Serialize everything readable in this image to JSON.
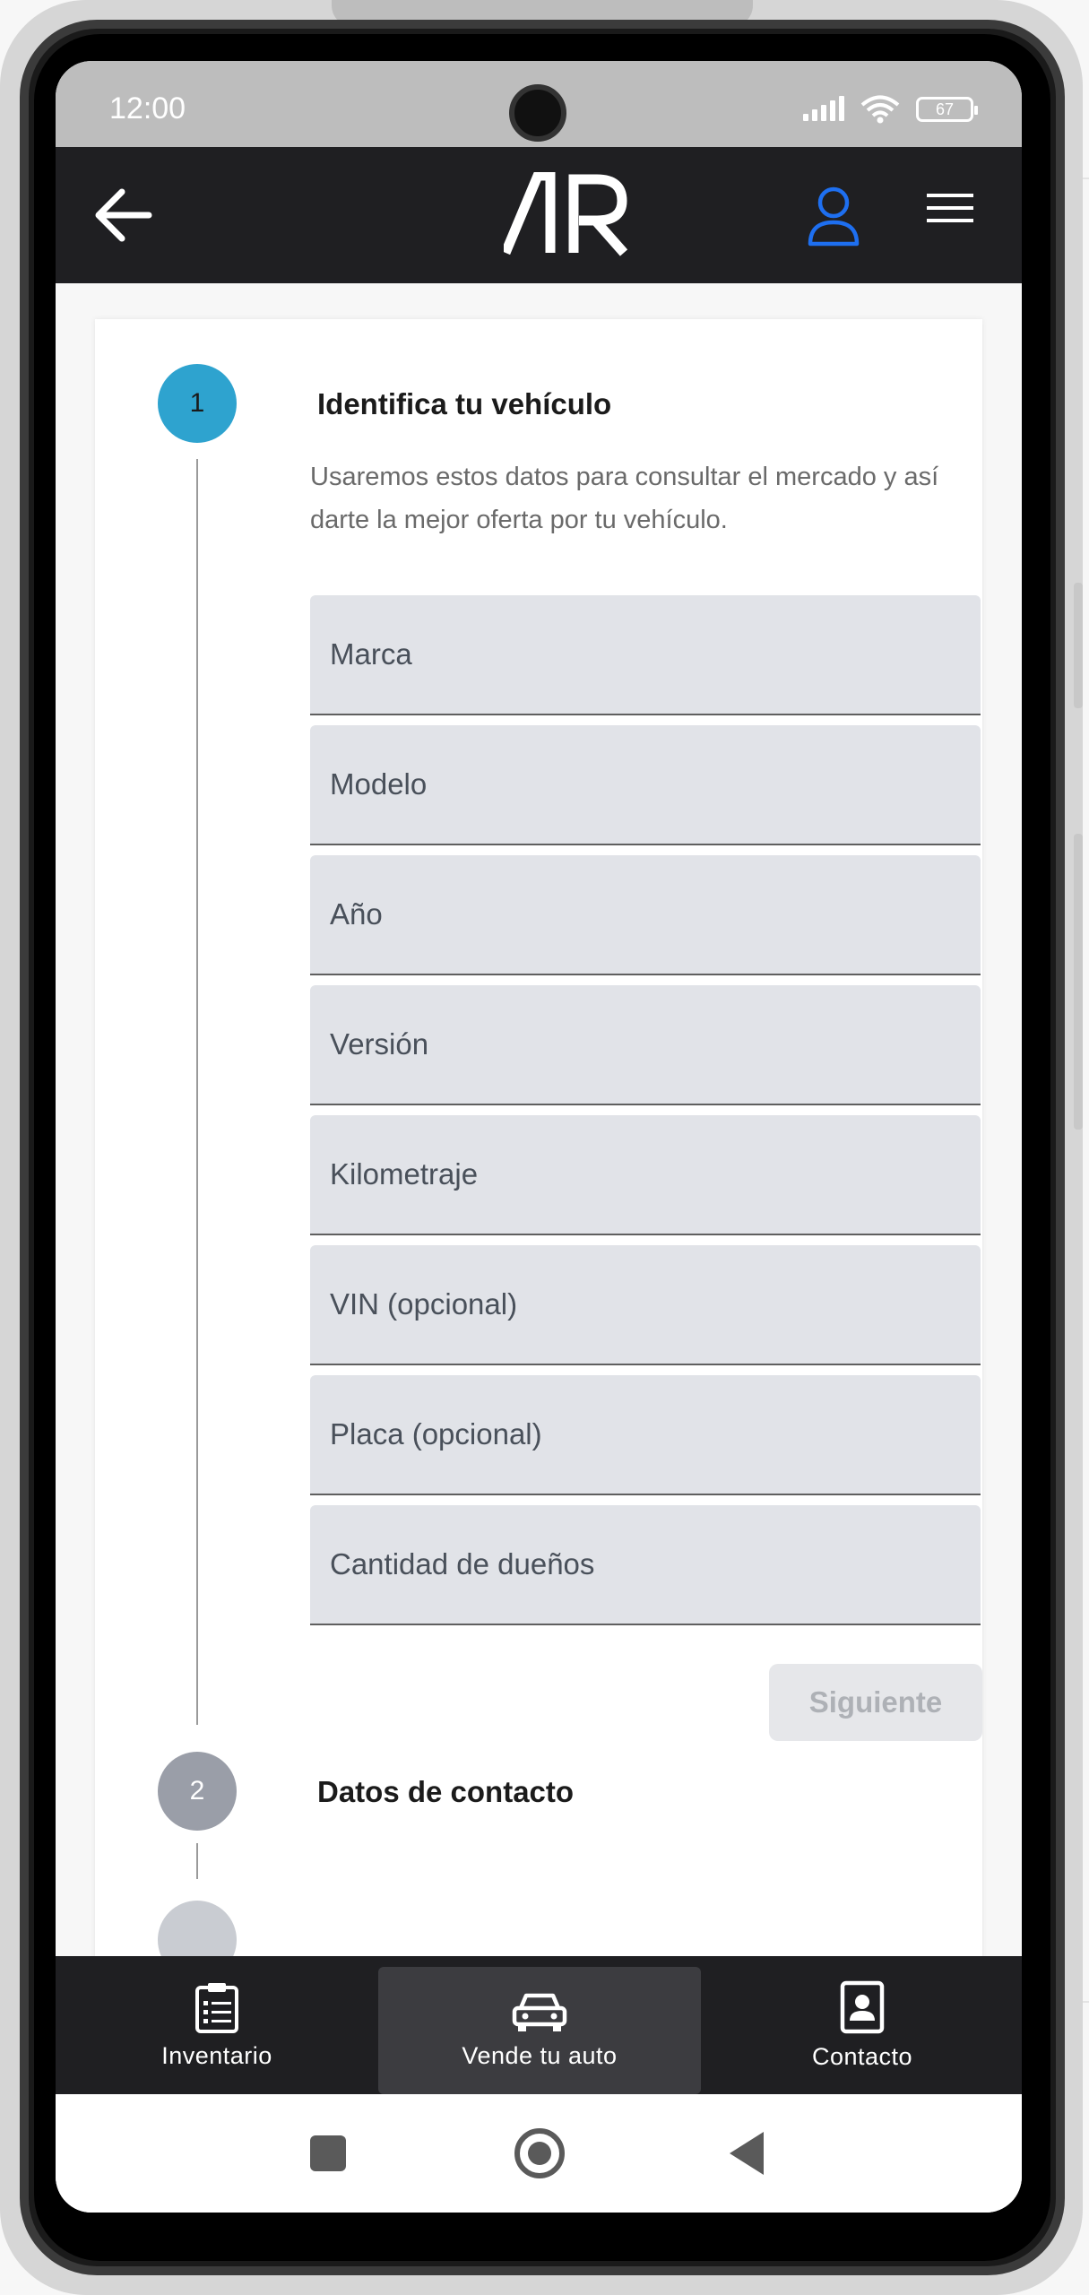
{
  "status_bar": {
    "time": "12:00",
    "battery": "67"
  },
  "header": {
    "logo_text": "AR",
    "back_icon": "arrow-left-icon",
    "user_icon": "user-icon",
    "menu_icon": "hamburger-menu-icon",
    "accent_color": "#1e6ff0"
  },
  "form": {
    "step1": {
      "number": "1",
      "title": "Identifica tu vehículo",
      "description": "Usaremos estos datos para consultar el mercado y así darte la mejor oferta por tu vehículo."
    },
    "fields": [
      {
        "placeholder": "Marca"
      },
      {
        "placeholder": "Modelo"
      },
      {
        "placeholder": "Año"
      },
      {
        "placeholder": "Versión"
      },
      {
        "placeholder": "Kilometraje"
      },
      {
        "placeholder": "VIN (opcional)"
      },
      {
        "placeholder": "Placa (opcional)"
      },
      {
        "placeholder": "Cantidad de dueños"
      }
    ],
    "next_label": "Siguiente",
    "step2": {
      "number": "2",
      "title": "Datos de contacto"
    }
  },
  "bottom_nav": {
    "items": [
      {
        "label": "Inventario",
        "icon": "clipboard-list-icon"
      },
      {
        "label": "Vende tu auto",
        "icon": "car-icon",
        "active": true
      },
      {
        "label": "Contacto",
        "icon": "contact-card-icon"
      }
    ]
  },
  "colors": {
    "header_bg": "#1f1f22",
    "step_active": "#2ea3cf",
    "step_inactive": "#9a9ea8",
    "field_bg": "#e1e3e8"
  }
}
